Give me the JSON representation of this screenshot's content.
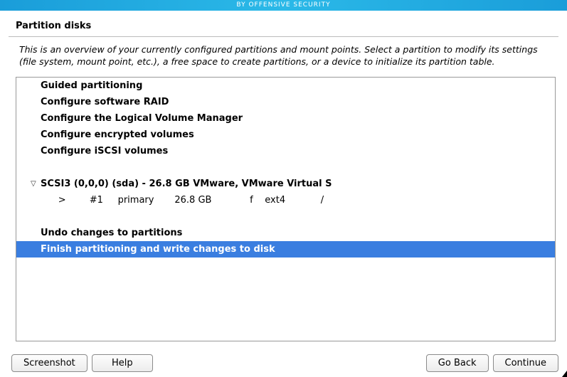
{
  "banner": "BY OFFENSIVE SECURITY",
  "title": "Partition disks",
  "description": "This is an overview of your currently configured partitions and mount points. Select a partition to modify its settings (file system, mount point, etc.), a free space to create partitions, or a device to initialize its partition table.",
  "options": {
    "guided": "Guided partitioning",
    "raid": "Configure software RAID",
    "lvm": "Configure the Logical Volume Manager",
    "encrypted": "Configure encrypted volumes",
    "iscsi": "Configure iSCSI volumes"
  },
  "disk": {
    "header": "SCSI3 (0,0,0) (sda) - 26.8 GB VMware, VMware Virtual S",
    "part1": "      >        #1     primary       26.8 GB             f    ext4            /"
  },
  "actions": {
    "undo": "Undo changes to partitions",
    "finish": "Finish partitioning and write changes to disk"
  },
  "buttons": {
    "screenshot": "Screenshot",
    "help": "Help",
    "goback": "Go Back",
    "continue": "Continue"
  }
}
